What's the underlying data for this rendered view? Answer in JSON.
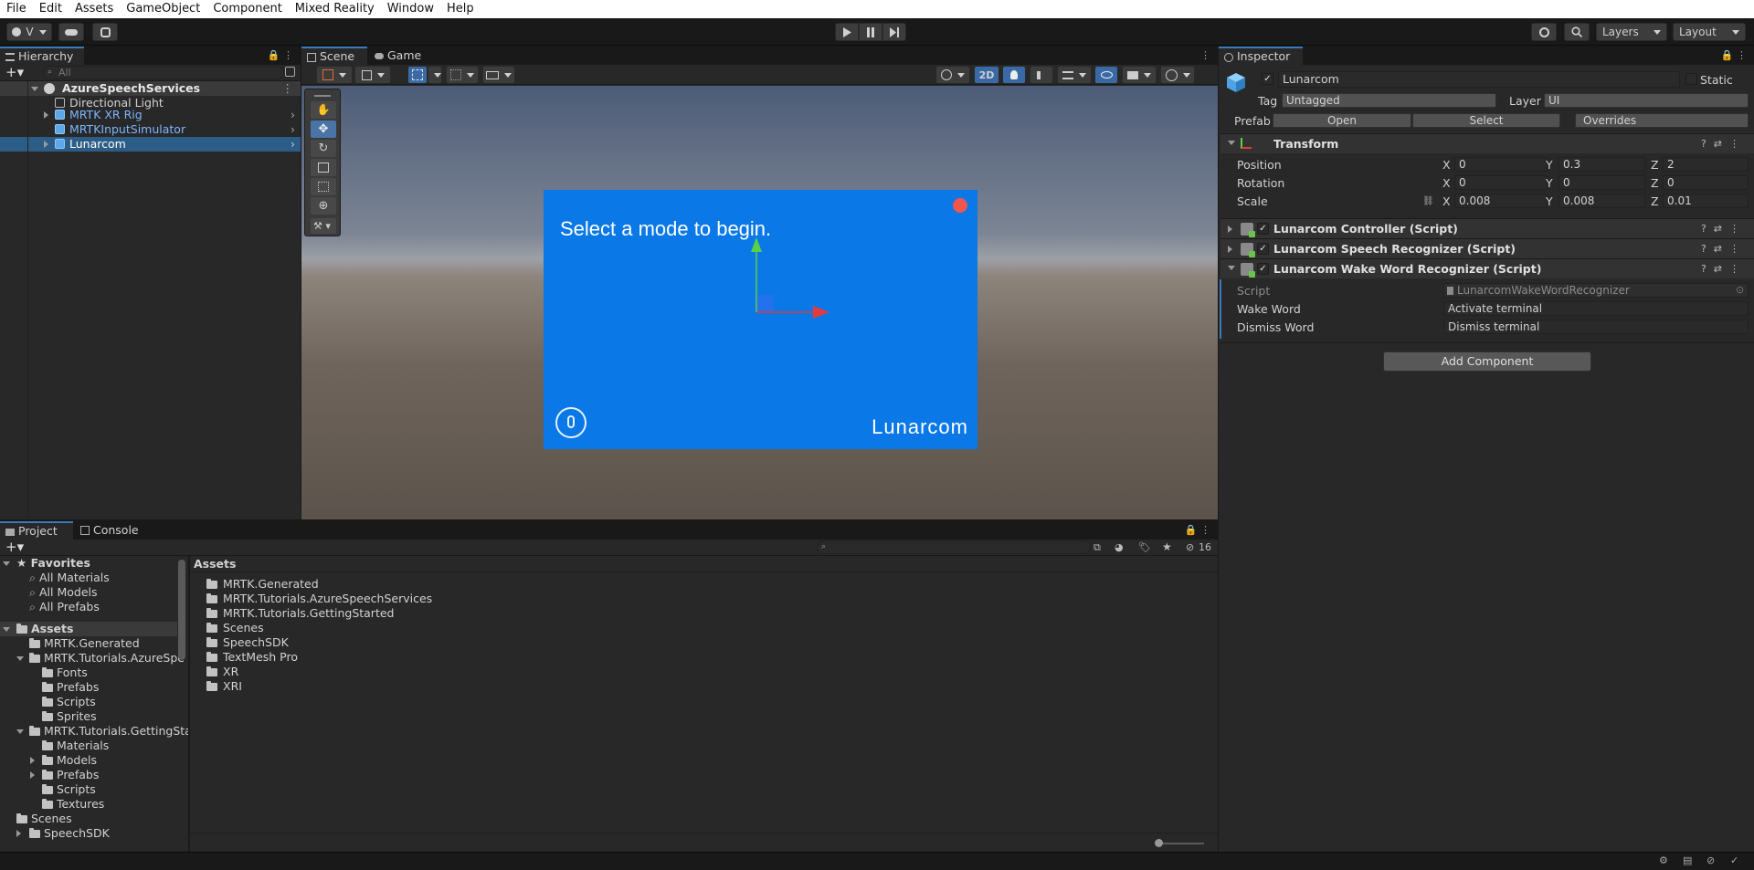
{
  "menu": [
    "File",
    "Edit",
    "Assets",
    "GameObject",
    "Component",
    "Mixed Reality",
    "Window",
    "Help"
  ],
  "toolbar": {
    "account": "V",
    "layers": "Layers",
    "layout": "Layout"
  },
  "hierarchy": {
    "tab": "Hierarchy",
    "search_placeholder": "All",
    "scene": "AzureSpeechServices",
    "items": [
      "Directional Light",
      "MRTK XR Rig",
      "MRTKInputSimulator",
      "Lunarcom"
    ]
  },
  "scene": {
    "tabs": [
      "Scene",
      "Game"
    ],
    "mode2d": "2D",
    "canvas_text": "Select a mode to begin.",
    "brand": "Lunarcom"
  },
  "inspector": {
    "tab": "Inspector",
    "object_name": "Lunarcom",
    "static_label": "Static",
    "tag_label": "Tag",
    "tag_value": "Untagged",
    "layer_label": "Layer",
    "layer_value": "UI",
    "prefab_label": "Prefab",
    "open": "Open",
    "select": "Select",
    "overrides": "Overrides",
    "transform": {
      "title": "Transform",
      "position_label": "Position",
      "rotation_label": "Rotation",
      "scale_label": "Scale",
      "axes": [
        "X",
        "Y",
        "Z"
      ],
      "position": [
        "0",
        "0.3",
        "2"
      ],
      "rotation": [
        "0",
        "0",
        "0"
      ],
      "scale": [
        "0.008",
        "0.008",
        "0.01"
      ]
    },
    "components": [
      "Lunarcom Controller (Script)",
      "Lunarcom Speech Recognizer (Script)",
      "Lunarcom Wake Word Recognizer (Script)"
    ],
    "script_label": "Script",
    "script_value": "LunarcomWakeWordRecognizer",
    "wake_label": "Wake Word",
    "wake_value": "Activate terminal",
    "dismiss_label": "Dismiss Word",
    "dismiss_value": "Dismiss terminal",
    "add_component": "Add Component"
  },
  "project": {
    "tabs": [
      "Project",
      "Console"
    ],
    "favorites_label": "Favorites",
    "favorites": [
      "All Materials",
      "All Models",
      "All Prefabs"
    ],
    "assets_label": "Assets",
    "tree": [
      "MRTK.Generated",
      "MRTK.Tutorials.AzureSpe",
      "Fonts",
      "Prefabs",
      "Scripts",
      "Sprites",
      "MRTK.Tutorials.GettingSta",
      "Materials",
      "Models",
      "Prefabs",
      "Scripts",
      "Textures",
      "Scenes",
      "SpeechSDK"
    ],
    "breadcrumb": "Assets",
    "folders": [
      "MRTK.Generated",
      "MRTK.Tutorials.AzureSpeechServices",
      "MRTK.Tutorials.GettingStarted",
      "Scenes",
      "SpeechSDK",
      "TextMesh Pro",
      "XR",
      "XRI"
    ],
    "hidden_count": "16"
  },
  "colors": {
    "accent": "#3a79bb",
    "canvas": "#0a78e6",
    "close_dot": "#f0554f"
  }
}
